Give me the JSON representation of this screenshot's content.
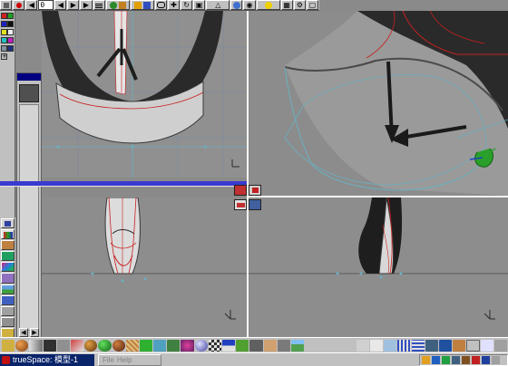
{
  "app": {
    "task_label": "trueSpace: 模型-1"
  },
  "toolbar": {
    "frame_value": "0",
    "record_icon": "record-icon",
    "play_icons": [
      "go-start-icon",
      "step-back-icon",
      "play-icon",
      "go-end-icon"
    ]
  },
  "menu": {
    "items": [
      "File",
      "Help"
    ]
  },
  "colors": {
    "selection_blue": "#3a3ad0",
    "viewport_gray": "#8c8c8c",
    "model_edge_red": "#c82020",
    "grid_cyan": "#7ec8c8",
    "axis_green": "#2aa02a",
    "taskbar_blue": "#0a246a"
  }
}
